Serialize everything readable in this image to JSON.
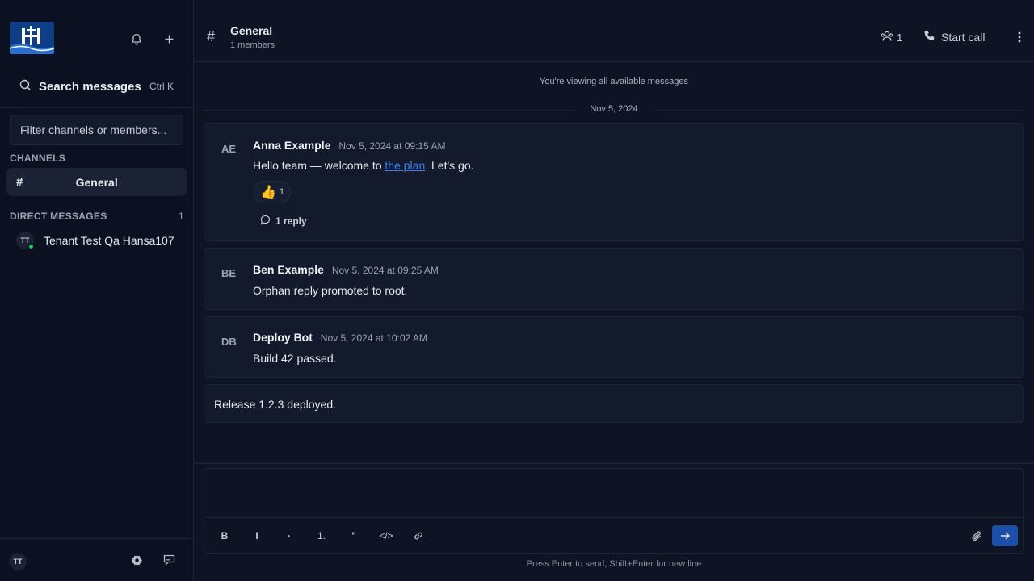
{
  "sidebar": {
    "search_label": "Search messages",
    "search_shortcut": "Ctrl K",
    "filter_placeholder": "Filter channels or members...",
    "channels_heading": "CHANNELS",
    "channels": [
      {
        "hash": "#",
        "label": "General"
      }
    ],
    "dm_heading": "DIRECT MESSAGES",
    "dm_count": "1",
    "dms": [
      {
        "initials": "TT",
        "name": "Tenant Test Qa Hansa107"
      }
    ],
    "user_initials": "TT"
  },
  "header": {
    "hash": "#",
    "title": "General",
    "subtitle": "1 members",
    "members_count": "1",
    "start_call_label": "Start call"
  },
  "feed": {
    "viewing_notice": "You're viewing all available messages",
    "date_divider": "Nov 5, 2024",
    "messages": [
      {
        "initials": "AE",
        "author": "Anna Example",
        "time": "Nov 5, 2024 at 09:15 AM",
        "text_before": "Hello team — welcome to ",
        "link_text": "the plan",
        "text_after": ". Let's go.",
        "reaction_emoji": "👍",
        "reaction_count": "1",
        "replies": "1 reply"
      },
      {
        "initials": "BE",
        "author": "Ben Example",
        "time": "Nov 5, 2024 at 09:25 AM",
        "text": "Orphan reply promoted to root."
      },
      {
        "initials": "DB",
        "author": "Deploy Bot",
        "time": "Nov 5, 2024 at 10:02 AM",
        "text": "Build 42 passed."
      },
      {
        "text": "Release 1.2.3 deployed."
      }
    ]
  },
  "composer": {
    "toolbar": {
      "bold": "B",
      "italic": "I",
      "bullet": "·",
      "numbered": "1.",
      "quote": "\"",
      "code": "</>"
    },
    "hint": "Press Enter to send, Shift+Enter for new line"
  },
  "colors": {
    "accent": "#1e4fa8",
    "link": "#3b82f6",
    "online": "#22c55e"
  }
}
